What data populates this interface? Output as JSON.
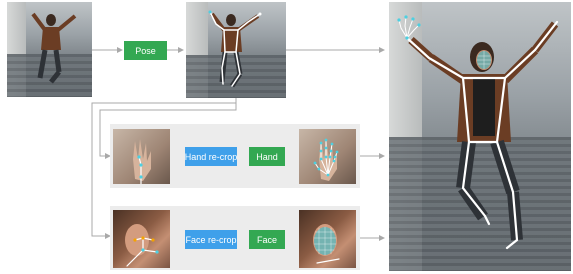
{
  "steps": {
    "pose": "Pose",
    "hand_recrop": "Hand re-crop",
    "hand": "Hand",
    "face_recrop": "Face re-crop",
    "face": "Face"
  },
  "colors": {
    "model_box": "#33a852",
    "crop_box": "#3fa0ea",
    "panel_bg": "#ececec",
    "arrow": "#a9a9a9",
    "skeleton": "#ffffff",
    "hand_landmarks": "#4dd0e1",
    "face_mesh": "#26c6da",
    "face_keypoints": "#f4a300"
  },
  "icons": {
    "input_photo": "person-photo",
    "pose_photo": "person-photo-with-pose-skeleton",
    "hand_crop": "hand-crop-photo",
    "hand_result": "hand-landmarks-photo",
    "face_crop": "face-crop-photo",
    "face_result": "face-mesh-photo",
    "output_photo": "full-holistic-result-photo"
  }
}
